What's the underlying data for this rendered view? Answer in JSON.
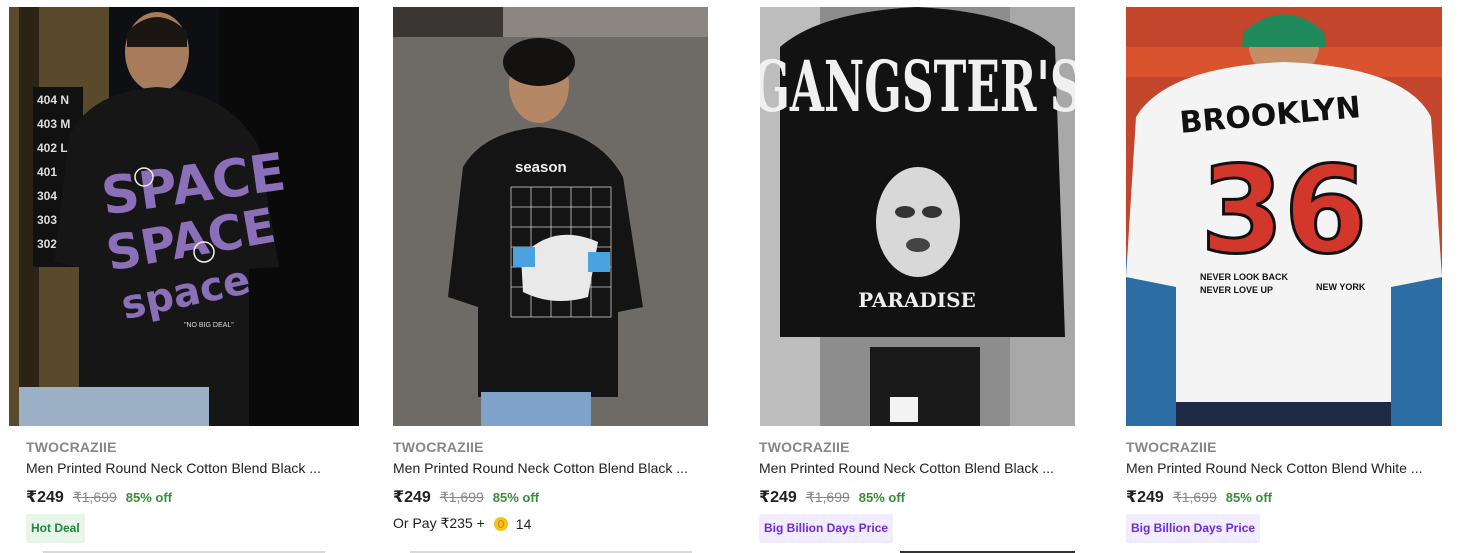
{
  "products": [
    {
      "brand": "TWOCRAZIIE",
      "title": "Men Printed Round Neck Cotton Blend Black ...",
      "price": "₹249",
      "mrp": "₹1,699",
      "discount": "85% off",
      "badge": "Hot Deal",
      "badge_type": "hot",
      "shirt_color": "#161616",
      "print_text": "SPACE"
    },
    {
      "brand": "TWOCRAZIIE",
      "title": "Men Printed Round Neck Cotton Blend Black ...",
      "price": "₹249",
      "mrp": "₹1,699",
      "discount": "85% off",
      "pay_prefix": "Or Pay ₹235 +",
      "coin_count": "14",
      "shirt_color": "#141414",
      "print_text": "season"
    },
    {
      "brand": "TWOCRAZIIE",
      "title": "Men Printed Round Neck Cotton Blend Black ...",
      "price": "₹249",
      "mrp": "₹1,699",
      "discount": "85% off",
      "badge": "Big Billion Days Price",
      "badge_type": "bbd",
      "shirt_color": "#121212",
      "print_text": "GANGSTER'S",
      "print_text_2": "PARADISE"
    },
    {
      "brand": "TWOCRAZIIE",
      "title": "Men Printed Round Neck Cotton Blend White ...",
      "price": "₹249",
      "mrp": "₹1,699",
      "discount": "85% off",
      "badge": "Big Billion Days Price",
      "badge_type": "bbd",
      "shirt_color": "#f4f4f4",
      "print_text": "BROOKLYN",
      "print_number": "36",
      "print_line_1": "NEVER LOOK BACK",
      "print_line_2": "NEVER LOVE UP",
      "print_line_3": "NEW YORK"
    }
  ],
  "icons": {
    "wishlist": "heart-icon",
    "coin": "supercoin-icon"
  },
  "colors": {
    "discount": "#388e3c",
    "hot_badge": "#1b8a3e",
    "bbd_badge": "#6f2bd8",
    "muted": "#878787"
  }
}
